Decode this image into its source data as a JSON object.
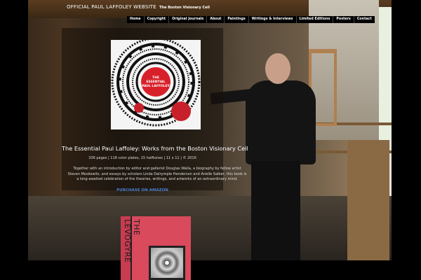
{
  "header": {
    "site_title": "OFFICIAL PAUL LAFFOLEY WEBSITE",
    "tagline": "The Boston Visionary Cell"
  },
  "nav": {
    "items": [
      "Home",
      "Copyright",
      "Original Journals",
      "About",
      "Paintings",
      "Writings & Interviews",
      "Limited Editions",
      "Posters",
      "Contact"
    ]
  },
  "feature": {
    "cover_text": "THE ESSENTIAL PAUL LAFFOLEY",
    "title": "The Essential Paul Laffoley: Works from the Boston Visionary Cell",
    "meta": "336 pages | 118 color plates, 15 halftones | 11 x 11 | © 2016",
    "description": "Together with an introduction by editor and gallerist Douglas Walla, a biography by fellow artist Steven Moskowitz, and essays by scholars Linda Dalrymple Henderson and Arielle Saiber, this book is a long-awaited celebration of the theories, writings, and artworks of an extraordinary mind.",
    "cta": "PURCHASE ON AMAZON"
  },
  "second_book": {
    "spine": "THE LEVOGYRE"
  },
  "colors": {
    "link": "#4a7fd0",
    "cover_red": "#d8202a",
    "book_pink": "#d94a5c"
  }
}
